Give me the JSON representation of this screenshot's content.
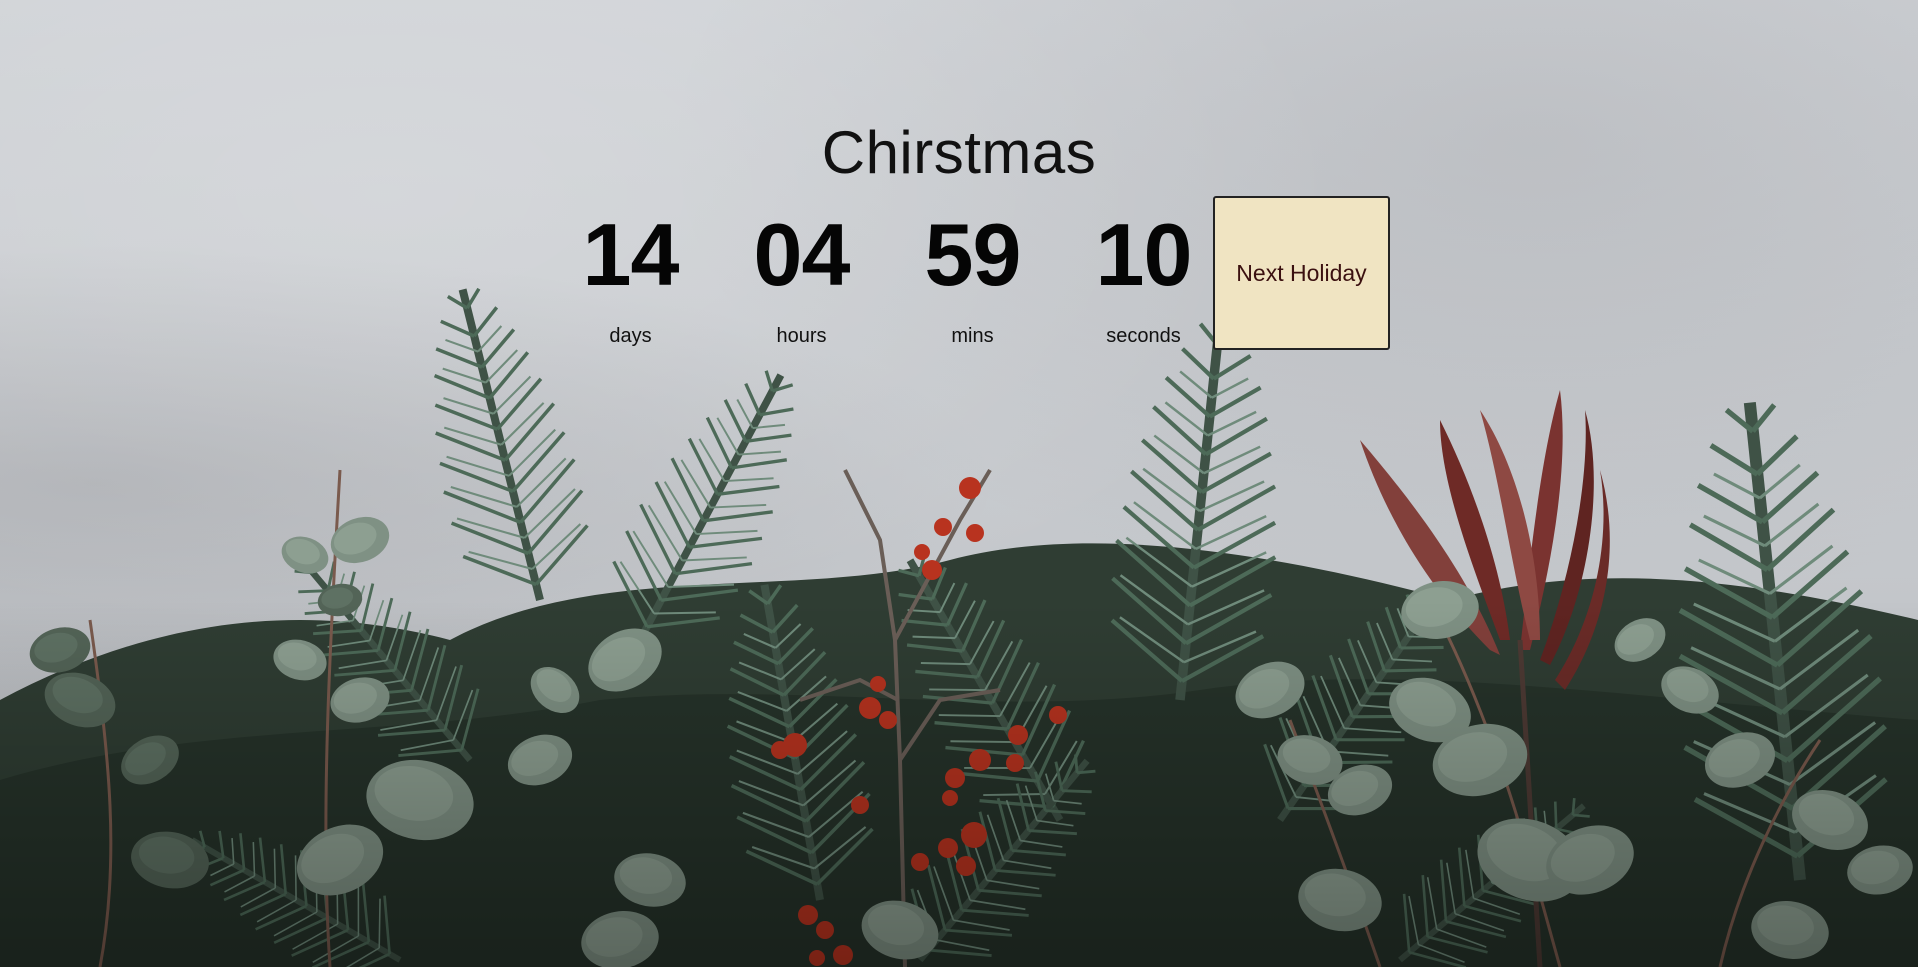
{
  "page": {
    "title": "Chirstmas"
  },
  "countdown": [
    {
      "value": "14",
      "label": "days"
    },
    {
      "value": "04",
      "label": "hours"
    },
    {
      "value": "59",
      "label": "mins"
    },
    {
      "value": "10",
      "label": "seconds"
    }
  ],
  "next_button": {
    "label": "Next Holiday"
  },
  "colors": {
    "button_bg": "#f0e4c2",
    "button_text": "#3b1010",
    "text": "#111111"
  }
}
